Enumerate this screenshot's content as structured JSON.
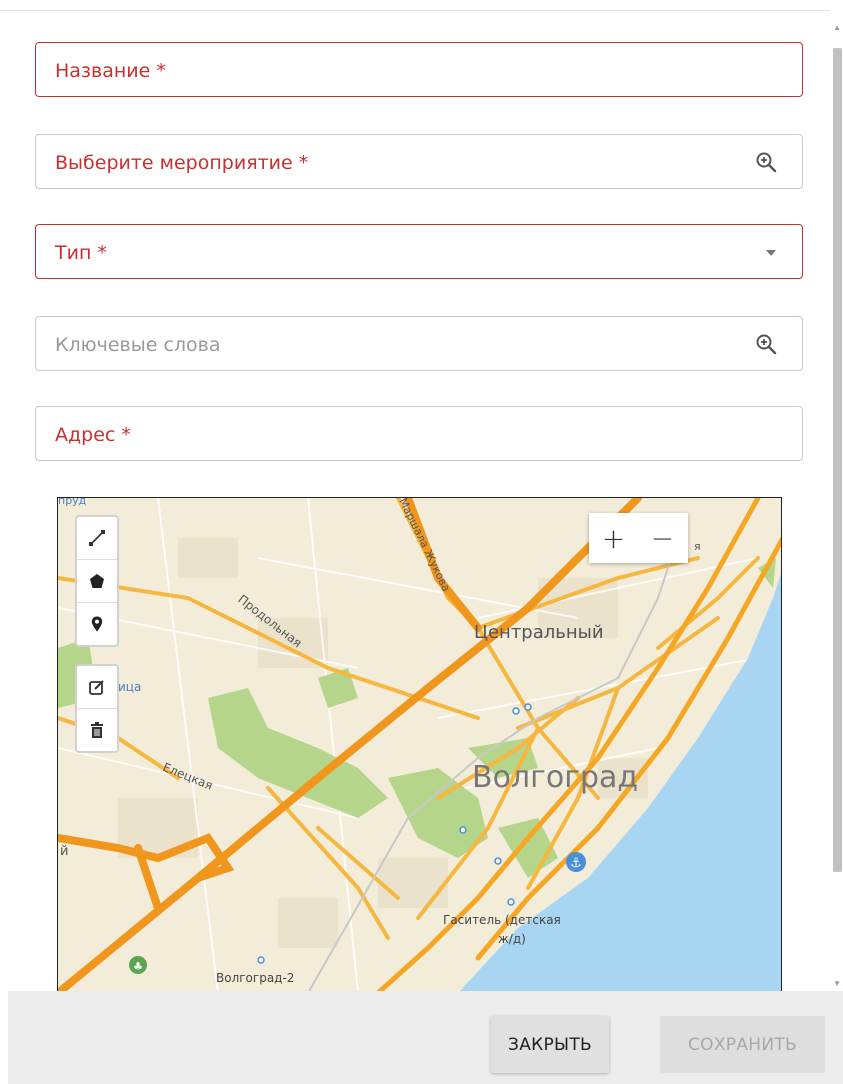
{
  "form": {
    "name_label": "Название *",
    "event_label": "Выберите мероприятие *",
    "type_label": "Тип *",
    "keywords_label": "Ключевые слова",
    "address_label": "Адрес *"
  },
  "map": {
    "labels": {
      "city": "Волгоград",
      "district": "Центральный",
      "street_prodolnaya": "Продольная",
      "street_eletskaya": "Елецкая",
      "street_zhukova": "Маршала Жукова",
      "station": "Волгоград-2",
      "gasitel_line1": "Гаситель (детская",
      "gasitel_line2": "ж/д)",
      "edge_top_left": "пруд",
      "edge_left_mid": "ица",
      "edge_left_low": "й",
      "edge_top_right": "я"
    },
    "zoom": {
      "in_label": "+",
      "out_label": "−"
    },
    "toolbar_icons": [
      "polyline-icon",
      "polygon-icon",
      "marker-icon",
      "edit-icon",
      "trash-icon"
    ],
    "colors": {
      "water": "#a8d5f2",
      "land": "#f3ecd9",
      "road": "#f5a623",
      "major_road": "#f0961c",
      "park": "#b5d58b"
    }
  },
  "footer": {
    "close_label": "ЗАКРЫТЬ",
    "save_label": "СОХРАНИТЬ"
  },
  "colors": {
    "error": "#c8302f",
    "border": "#c9c9c9"
  }
}
